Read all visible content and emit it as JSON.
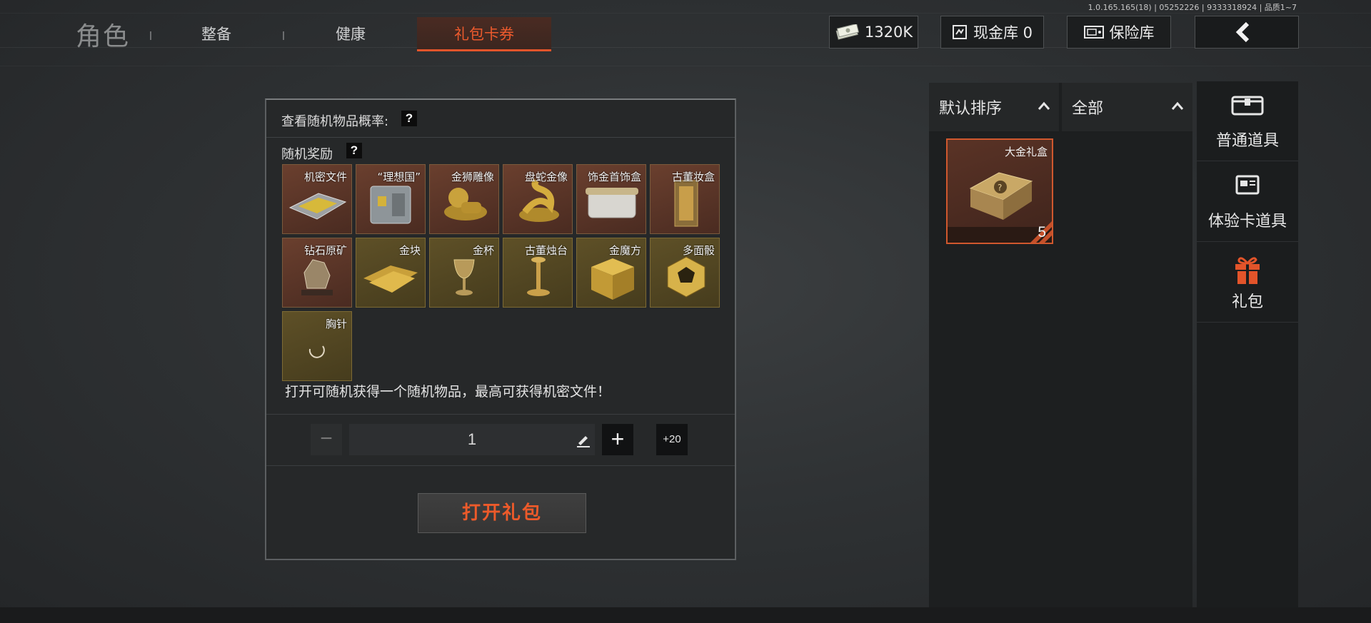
{
  "version": "1.0.165.165(18) | 05252226 | 9333318924 | 品质1~7",
  "nav": {
    "title": "角色",
    "tabs": [
      "整备",
      "健康",
      "礼包卡券"
    ],
    "active_tab": "礼包卡券"
  },
  "header": {
    "money": "1320K",
    "cash_vault": "现金库 0",
    "safe": "保险库"
  },
  "panel": {
    "prob_label": "查看随机物品概率:",
    "question_mark": "?",
    "rewards_label": "随机奖励",
    "rewards": [
      {
        "name": "机密文件",
        "bg": "brown",
        "icon": "document-case-icon"
      },
      {
        "name": "“理想国”",
        "bg": "brown",
        "icon": "safe-box-icon"
      },
      {
        "name": "金狮雕像",
        "bg": "brown",
        "icon": "gold-lion-icon"
      },
      {
        "name": "盘蛇金像",
        "bg": "brown",
        "icon": "gold-snake-icon"
      },
      {
        "name": "饰金首饰盒",
        "bg": "brown",
        "icon": "jewelry-box-icon"
      },
      {
        "name": "古董妆盒",
        "bg": "brown",
        "icon": "antique-case-icon"
      },
      {
        "name": "钻石原矿",
        "bg": "brown",
        "icon": "rough-diamond-icon"
      },
      {
        "name": "金块",
        "bg": "gold",
        "icon": "gold-bar-icon"
      },
      {
        "name": "金杯",
        "bg": "gold",
        "icon": "gold-cup-icon"
      },
      {
        "name": "古董烛台",
        "bg": "gold",
        "icon": "candlestick-icon"
      },
      {
        "name": "金魔方",
        "bg": "gold",
        "icon": "gold-cube-icon"
      },
      {
        "name": "多面骰",
        "bg": "gold",
        "icon": "dice-icon"
      },
      {
        "name": "胸针",
        "bg": "gold",
        "icon": "brooch-icon"
      }
    ],
    "description": "打开可随机获得一个随机物品，最高可获得机密文件！",
    "quantity": "1",
    "minus": "−",
    "plus": "+",
    "plus20": "+20",
    "open_button": "打开礼包"
  },
  "inventory": {
    "sort": "默认排序",
    "filter": "全部",
    "item": {
      "name": "大金礼盒",
      "count": "5"
    }
  },
  "categories": [
    {
      "label": "普通道具",
      "icon": "chest-icon",
      "active": false
    },
    {
      "label": "体验卡道具",
      "icon": "card-icon",
      "active": false
    },
    {
      "label": "礼包",
      "icon": "gift-icon",
      "active": true
    }
  ],
  "colors": {
    "accent": "#e2542a",
    "brown_tile": "#5a3528",
    "gold_tile": "#534623"
  }
}
